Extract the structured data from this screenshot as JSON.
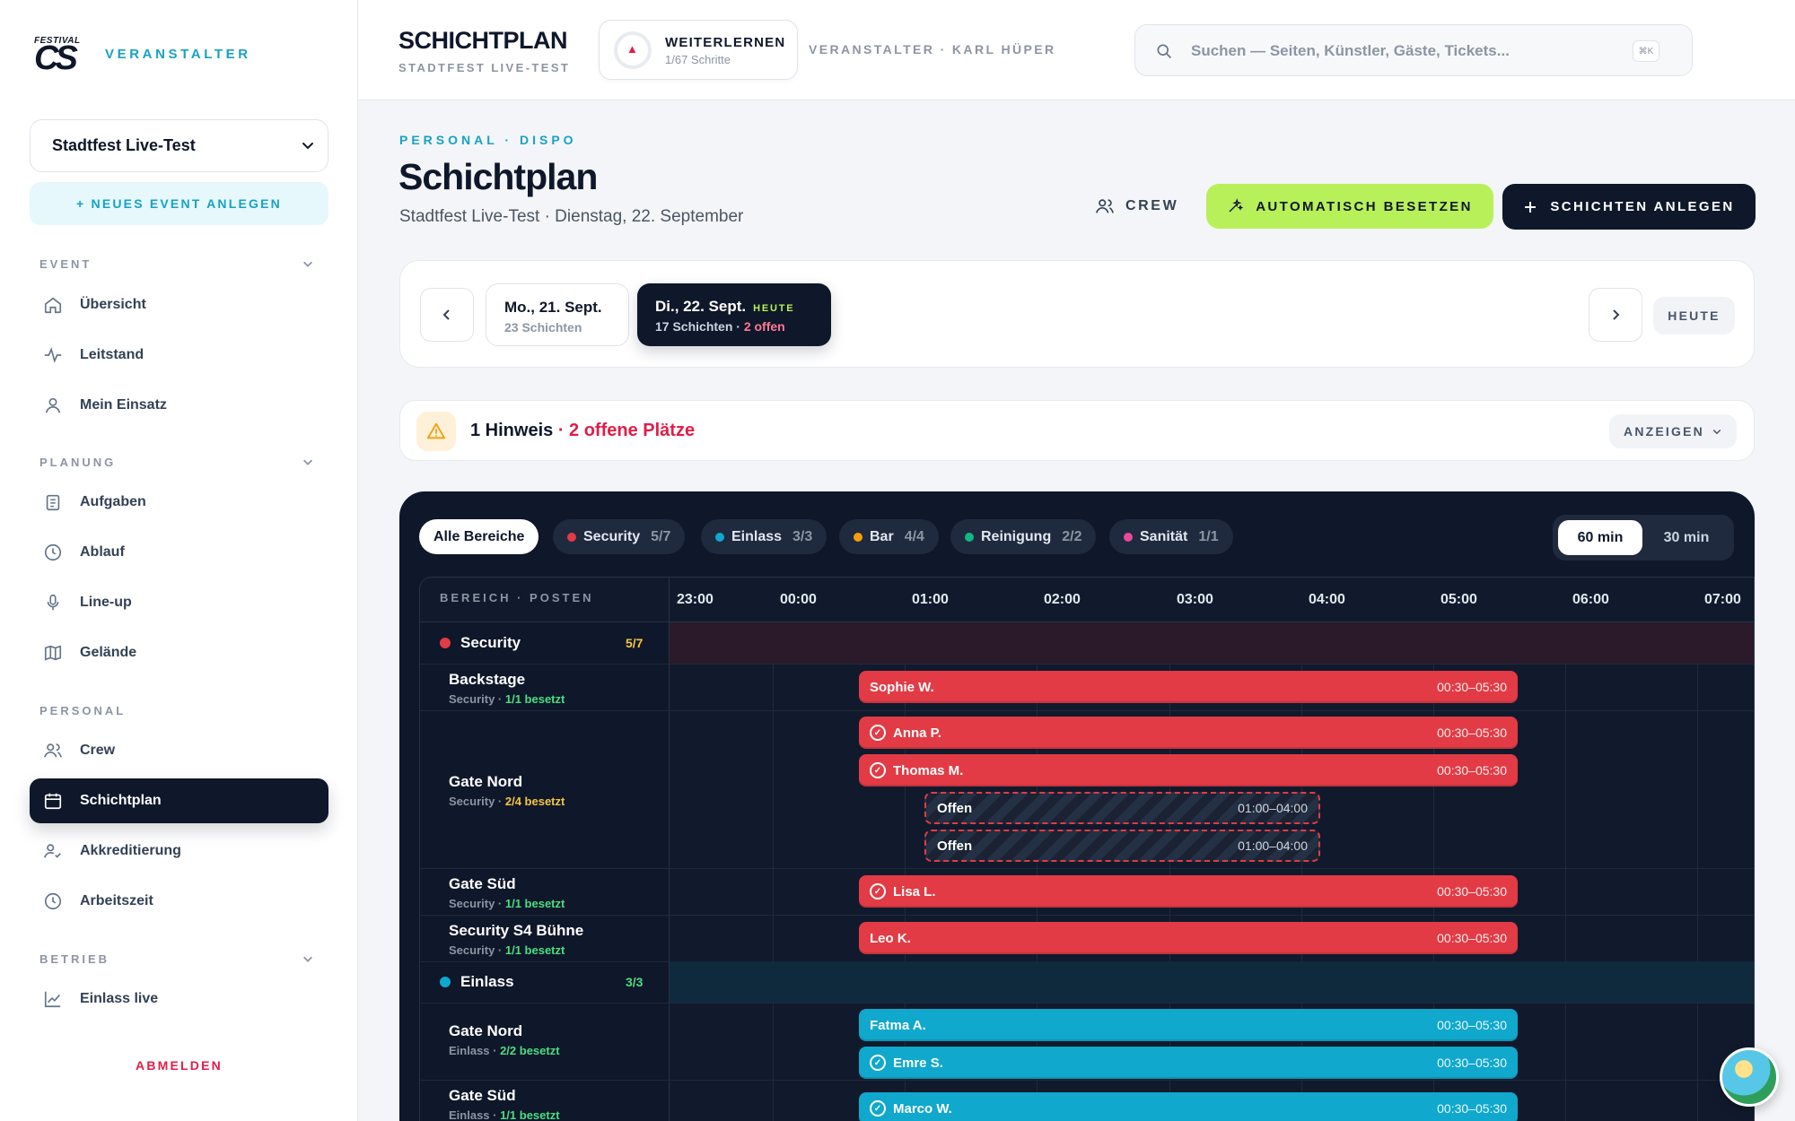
{
  "brand": {
    "logo_top": "FESTIVAL",
    "logo_main": "CS",
    "label": "VERANSTALTER"
  },
  "event_select": {
    "value": "Stadtfest Live-Test"
  },
  "new_event": "+ NEUES EVENT ANLEGEN",
  "nav": {
    "sections": [
      {
        "title": "EVENT"
      },
      {
        "title": "PLANUNG"
      },
      {
        "title": "PERSONAL"
      },
      {
        "title": "BETRIEB"
      }
    ],
    "items": [
      {
        "label": "Übersicht",
        "icon": "home-icon"
      },
      {
        "label": "Leitstand",
        "icon": "activity-icon"
      },
      {
        "label": "Mein Einsatz",
        "icon": "user-icon"
      },
      {
        "label": "Aufgaben",
        "icon": "clipboard-icon"
      },
      {
        "label": "Ablauf",
        "icon": "clock-icon"
      },
      {
        "label": "Line-up",
        "icon": "mic-icon"
      },
      {
        "label": "Gelände",
        "icon": "map-icon"
      },
      {
        "label": "Crew",
        "icon": "users-icon"
      },
      {
        "label": "Schichtplan",
        "icon": "calendar-icon"
      },
      {
        "label": "Akkreditierung",
        "icon": "user-check-icon"
      },
      {
        "label": "Arbeitszeit",
        "icon": "clock-icon"
      },
      {
        "label": "Einlass live",
        "icon": "chart-line-icon"
      }
    ],
    "active": "Schichtplan",
    "logout": "ABMELDEN"
  },
  "header": {
    "title": "SCHICHTPLAN",
    "subtitle": "STADTFEST LIVE-TEST",
    "learn_title": "WEITERLERNEN",
    "learn_progress": "1/67 Schritte",
    "user": "VERANSTALTER · KARL HÜPER",
    "search_placeholder": "Suchen — Seiten, Künstler, Gäste, Tickets...",
    "search_shortcut": "⌘K"
  },
  "page": {
    "kicker": "PERSONAL · DISPO",
    "title": "Schichtplan",
    "subtitle": "Stadtfest Live-Test · Dienstag, 22. September",
    "crew_button": "CREW",
    "auto_button": "AUTOMATISCH BESETZEN",
    "create_button": "SCHICHTEN ANLEGEN"
  },
  "days": {
    "prev": {
      "label": "Mo., 21. Sept.",
      "info": "23 Schichten"
    },
    "current": {
      "label": "Di., 22. Sept.",
      "badge": "HEUTE",
      "info": "17 Schichten · ",
      "open": "2 offen"
    },
    "today_button": "HEUTE"
  },
  "hint": {
    "count": "1 Hinweis",
    "detail": " · 2 offene Plätze",
    "show": "ANZEIGEN"
  },
  "filters": {
    "all": "Alle Bereiche",
    "areas": [
      {
        "name": "Security",
        "count": "5/7",
        "color": "#e23b45"
      },
      {
        "name": "Einlass",
        "count": "3/3",
        "color": "#10a8cc"
      },
      {
        "name": "Bar",
        "count": "4/4",
        "color": "#f59e0b"
      },
      {
        "name": "Reinigung",
        "count": "2/2",
        "color": "#10b981"
      },
      {
        "name": "Sanität",
        "count": "1/1",
        "color": "#ec4899"
      }
    ],
    "zoom": [
      "60 min",
      "30 min"
    ]
  },
  "timeline": {
    "column_header": "BEREICH · POSTEN",
    "ticks": [
      "23:00",
      "00:00",
      "01:00",
      "02:00",
      "03:00",
      "04:00",
      "05:00",
      "06:00",
      "07:00"
    ]
  },
  "schedule": {
    "security": {
      "name": "Security",
      "count": "5/7",
      "color": "#e23b45"
    },
    "einlass": {
      "name": "Einlass",
      "count": "3/3",
      "color": "#10a8cc"
    },
    "posts": [
      {
        "name": "Backstage",
        "area": "Security · ",
        "status": "1/1 besetzt"
      },
      {
        "name": "Gate Nord",
        "area": "Security · ",
        "status": "2/4 besetzt"
      },
      {
        "name": "Gate Süd",
        "area": "Security · ",
        "status": "1/1 besetzt"
      },
      {
        "name": "Security S4 Bühne",
        "area": "Security · ",
        "status": "1/1 besetzt"
      },
      {
        "name": "Gate Nord",
        "area": "Einlass · ",
        "status": "2/2 besetzt"
      },
      {
        "name": "Gate Süd",
        "area": "Einlass · ",
        "status": "1/1 besetzt"
      }
    ],
    "shifts": [
      {
        "name": "Sophie W.",
        "time": "00:30–05:30"
      },
      {
        "name": "Anna P.",
        "time": "00:30–05:30"
      },
      {
        "name": "Thomas M.",
        "time": "00:30–05:30"
      },
      {
        "name": "Offen",
        "time": "01:00–04:00"
      },
      {
        "name": "Offen",
        "time": "01:00–04:00"
      },
      {
        "name": "Lisa L.",
        "time": "00:30–05:30"
      },
      {
        "name": "Leo K.",
        "time": "00:30–05:30"
      },
      {
        "name": "Fatma A.",
        "time": "00:30–05:30"
      },
      {
        "name": "Emre S.",
        "time": "00:30–05:30"
      },
      {
        "name": "Marco W.",
        "time": "00:30–05:30"
      }
    ]
  }
}
